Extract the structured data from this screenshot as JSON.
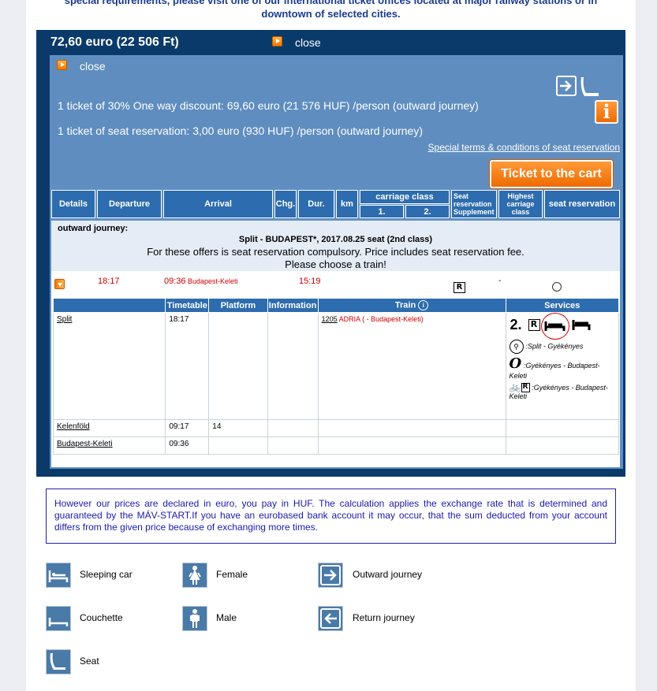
{
  "top_note": {
    "line1": "special requirements, please visit one of our international ticket offices located at major railway stations or in",
    "line2": "downtown of selected cities."
  },
  "offer": {
    "price": "72,60 euro (22 506 Ft)",
    "close_label": "close",
    "detail_close_label": "close",
    "line1": "1 ticket of 30% One way discount: 69,60 euro (21 576 HUF) /person (outward journey)",
    "line2": "1 ticket of seat reservation: 3,00 euro (930 HUF) /person (outward journey)",
    "terms_link": "Special terms & conditions of seat reservation",
    "cart_button": "Ticket to the cart",
    "info_icon_char": "i"
  },
  "headers": {
    "details": "Details",
    "departure": "Departure",
    "arrival": "Arrival",
    "chg": "Chg.",
    "dur": "Dur.",
    "km": "km",
    "carriage_class": "carriage class",
    "class1": "1.",
    "class2": "2.",
    "seat_res_supp": "Seat reservation Supplement",
    "highest_class": "Highest carriage class",
    "seat_reservation": "seat reservation"
  },
  "journey": {
    "label": "outward journey:",
    "title": "Split - BUDAPEST*, 2017.08.25 seat (2nd class)",
    "note1": "For these offers is seat reservation compulsory. Price includes seat reservation fee.",
    "note2": "Please choose a train!",
    "dep_time": "18:17",
    "arr_time": "09:36",
    "arr_station": "Budapest-Keleti",
    "duration": "15:19",
    "r_mark": "R",
    "dash": "-"
  },
  "timetable": {
    "headers": [
      "Timetable",
      "Platform",
      "Information",
      "Train",
      "Services"
    ],
    "rows": [
      {
        "station": "Split",
        "time": "18:17",
        "platform": "",
        "info": "",
        "train_no": "1205",
        "train_name": "ADRIA",
        "train_dest": "( - Budapest-Keleti)"
      },
      {
        "station": "Kelenföld",
        "time": "09:17",
        "platform": "14",
        "info": "",
        "train_no": "",
        "train_name": "",
        "train_dest": ""
      },
      {
        "station": "Budapest-Keleti",
        "time": "09:36",
        "platform": "",
        "info": "",
        "train_no": "",
        "train_name": "",
        "train_dest": ""
      }
    ],
    "services": {
      "class_num": "2.",
      "r_mark": "R",
      "bike_route": ":Split - Gyékényes",
      "zero_glyph": "O",
      "zero_route": ":Gyékényes - Budapest-Keleti",
      "bike_r_mark": "R",
      "bike_r_route": ":Gyékényes - Budapest-Keleti"
    }
  },
  "currency_note": "However our prices are declared in euro, you pay in HUF. The calculation applies the exchange rate that is determined and guaranteed by the MÁV-START.If you have an eurobased bank account it may occur, that the sum deducted from your account differs from the given price because of exchanging more times.",
  "legend": {
    "sleeping_car": "Sleeping car",
    "female": "Female",
    "outward": "Outward journey",
    "couchette": "Couchette",
    "male": "Male",
    "return": "Return journey",
    "seat": "Seat"
  },
  "colors": {
    "dark_blue": "#0a3a6a",
    "header_blue": "#2d6cae",
    "orange": "#ef6a00",
    "red_text": "#d00000"
  }
}
